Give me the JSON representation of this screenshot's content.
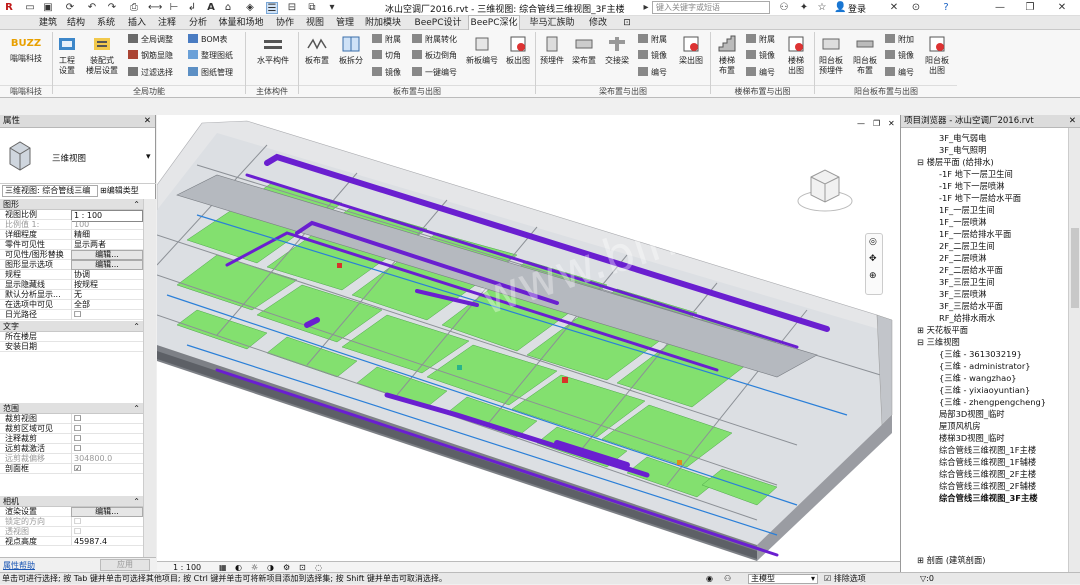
{
  "app": {
    "doc_title": "冰山空调厂2016.rvt - 三维视图: 综合管线三维视图_3F主楼",
    "search_placeholder": "键入关键字或短语",
    "user": "登录"
  },
  "tabs": [
    "建筑",
    "结构",
    "系统",
    "插入",
    "注释",
    "分析",
    "体量和场地",
    "协作",
    "视图",
    "管理",
    "附加模块",
    "BeePC设计",
    "BeePC深化",
    "毕马汇族助手",
    "修改"
  ],
  "active_tab": "BeePC深化",
  "ribbon": {
    "panels": [
      "嗡嗡科技",
      "全局功能",
      "主体构件",
      "板布置与出图",
      "梁布置与出图",
      "楼梯布置与出图",
      "阳台板布置与出图"
    ],
    "buzz": {
      "logo": "BUZZ",
      "label": "嗡嗡科技"
    },
    "global": {
      "project_settings": "工程\n设置",
      "assembly": "装配式\n楼层设置",
      "global_adjust": "全局调整",
      "rebar_hide": "钢筋显隐",
      "filter_select": "过滤选择",
      "bom": "BOM表",
      "organize": "整理图纸",
      "drawing_mgmt": "图纸管理"
    },
    "main": {
      "horizontal": "水平构件"
    },
    "slab": {
      "slab_layout": "板布置",
      "slab_split": "板拆分",
      "attach": "附属",
      "chamfer": "切角",
      "mirror": "镜像",
      "attach_convert": "附属转化",
      "slab_edge": "板边倒角",
      "one_key_number": "一键编号",
      "new_slab_number": "新板编号",
      "slab_drawing": "板出图"
    },
    "beam": {
      "prefab_beam": "预埋件",
      "beam_layout": "梁布置",
      "cross_beam": "交接梁",
      "attach": "附属",
      "mirror": "镜像",
      "number": "编号",
      "beam_drawing": "梁出图"
    },
    "stair": {
      "stair_layout": "楼梯\n布置",
      "attach": "附属",
      "mirror": "镜像",
      "number": "编号",
      "stair_drawing": "楼梯\n出图"
    },
    "balcony": {
      "prefab": "阳台板\n预埋件",
      "layout": "阳台板\n布置",
      "attach": "附加",
      "mirror": "镜像",
      "number": "编号",
      "drawing": "阳台板\n出图"
    }
  },
  "properties": {
    "title": "属性",
    "type_name": "三维视图",
    "selector": "三维视图: 综合管线三编",
    "edit_type": "编辑类型",
    "groups": {
      "graphics": "图形",
      "text": "文字",
      "extents": "范围",
      "camera": "相机"
    },
    "rows": [
      {
        "k": "视图比例",
        "v": "1 : 100"
      },
      {
        "k": "比例值 1:",
        "v": "100"
      },
      {
        "k": "详细程度",
        "v": "精细"
      },
      {
        "k": "零件可见性",
        "v": "显示两者"
      },
      {
        "k": "可见性/图形替换",
        "v": "编辑..."
      },
      {
        "k": "图形显示选项",
        "v": "编辑..."
      },
      {
        "k": "规程",
        "v": "协调"
      },
      {
        "k": "显示隐藏线",
        "v": "按规程"
      },
      {
        "k": "默认分析显示...",
        "v": "无"
      },
      {
        "k": "在选项中可见",
        "v": "全部"
      },
      {
        "k": "日光路径",
        "v": "☐"
      },
      {
        "k": "所在楼层",
        "v": ""
      },
      {
        "k": "安装日期",
        "v": ""
      },
      {
        "k": "裁剪视图",
        "v": "☐"
      },
      {
        "k": "裁剪区域可见",
        "v": "☐"
      },
      {
        "k": "注释裁剪",
        "v": "☐"
      },
      {
        "k": "远剪裁激活",
        "v": "☐"
      },
      {
        "k": "远剪裁偏移",
        "v": "304800.0"
      },
      {
        "k": "剖面框",
        "v": "☑"
      },
      {
        "k": "渲染设置",
        "v": "编辑..."
      },
      {
        "k": "锁定的方向",
        "v": "☐"
      },
      {
        "k": "透视图",
        "v": "☐"
      },
      {
        "k": "视点高度",
        "v": "45987.4"
      }
    ],
    "help": "属性帮助",
    "apply": "应用"
  },
  "viewbar": {
    "scale": "1 : 100"
  },
  "browser": {
    "title": "项目浏览器 - 冰山空调厂2016.rvt",
    "items": [
      "3F_电气弱电",
      "3F_电气照明",
      "楼层平面 (给排水)",
      "-1F 地下一层卫生间",
      "-1F 地下一层喷淋",
      "-1F 地下一层给水平面",
      "1F_一层卫生间",
      "1F_一层喷淋",
      "1F_一层给排水平面",
      "2F_二层卫生间",
      "2F_二层喷淋",
      "2F_二层给水平面",
      "3F_三层卫生间",
      "3F_三层喷淋",
      "3F_三层给水平面",
      "RF_给排水雨水",
      "天花板平面",
      "三维视图",
      "{三维 - 361303219}",
      "{三维 - administrator}",
      "{三维 - wangzhao}",
      "{三维 - yixiaoyuntian}",
      "{三维 - zhengpengcheng}",
      "局部3D视图_临时",
      "屋顶风机房",
      "楼梯3D视图_临时",
      "综合管线三维视图_1F主楼",
      "综合管线三维视图_1F辅楼",
      "综合管线三维视图_2F主楼",
      "综合管线三维视图_2F辅楼",
      "综合管线三维视图_3F主楼",
      "剖面 (建筑剖面)"
    ]
  },
  "status": {
    "text": "单击可进行选择; 按 Tab 键并单击可选择其他项目; 按 Ctrl 键并单击可将新项目添加到选择集; 按 Shift 键并单击可取消选择。",
    "model": "主模型",
    "exclude": "排除选项"
  },
  "colors": {
    "purple": "#6a1fd0",
    "green": "#7ddc6a",
    "steel": "#9aa0a8"
  }
}
